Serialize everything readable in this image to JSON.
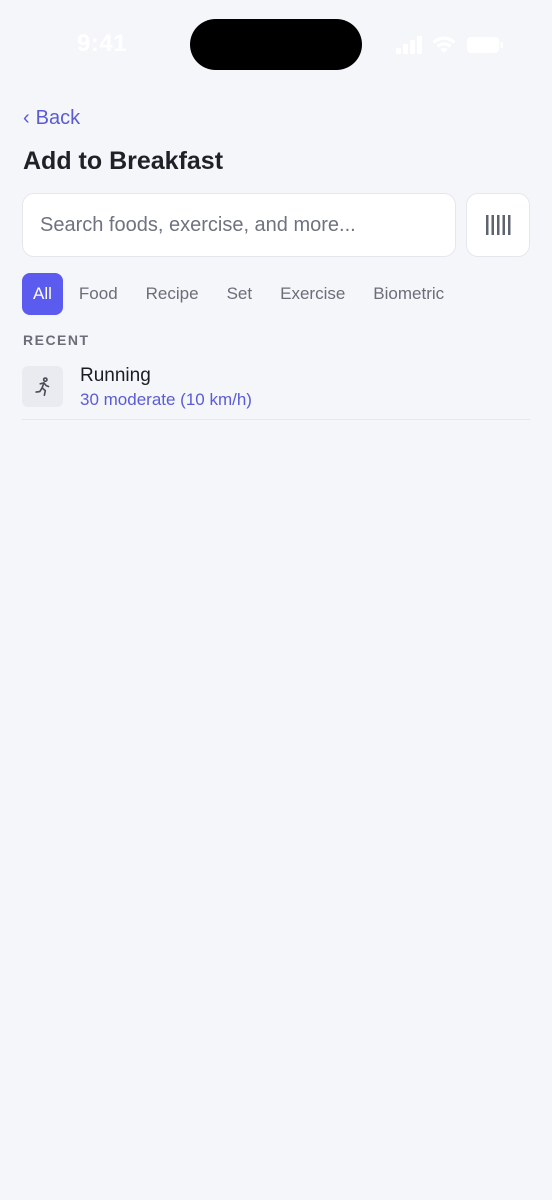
{
  "status_bar": {
    "time": "9:41"
  },
  "nav": {
    "back_label": "Back"
  },
  "page": {
    "title": "Add to Breakfast"
  },
  "search": {
    "placeholder": "Search foods, exercise, and more...",
    "value": ""
  },
  "icons": {
    "back": "chevron-left-icon",
    "barcode": "barcode-icon",
    "running": "running-person-icon",
    "signal": "cellular-signal-icon",
    "wifi": "wifi-icon",
    "battery": "battery-icon"
  },
  "filters": {
    "active_index": 0,
    "items": [
      {
        "label": "All"
      },
      {
        "label": "Food"
      },
      {
        "label": "Recipe"
      },
      {
        "label": "Set"
      },
      {
        "label": "Exercise"
      },
      {
        "label": "Biometric"
      }
    ]
  },
  "recent": {
    "section_label": "RECENT",
    "items": [
      {
        "title": "Running",
        "subtitle": "30 moderate (10 km/h)"
      }
    ]
  },
  "colors": {
    "accent": "#5b5bef",
    "link": "#5b5bd6",
    "background": "#f4f6fa"
  }
}
